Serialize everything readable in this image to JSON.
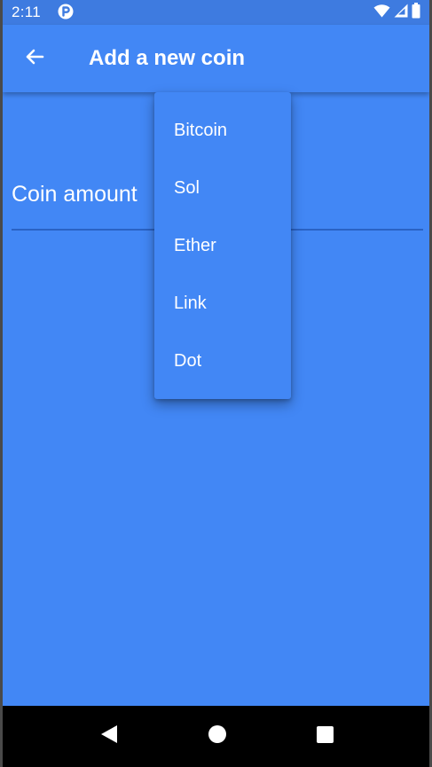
{
  "status_bar": {
    "time": "2:11",
    "app_icon": "p-circle-icon",
    "right_icons": [
      "wifi-icon",
      "signal-icon",
      "battery-icon"
    ]
  },
  "app_bar": {
    "back_icon": "arrow-back-icon",
    "title": "Add a new coin"
  },
  "form": {
    "coin_amount_label": "Coin amount"
  },
  "dropdown": {
    "items": [
      {
        "label": "Bitcoin"
      },
      {
        "label": "Sol"
      },
      {
        "label": "Ether"
      },
      {
        "label": "Link"
      },
      {
        "label": "Dot"
      }
    ]
  },
  "nav_bar": {
    "back_icon": "triangle-back-icon",
    "home_icon": "circle-home-icon",
    "recents_icon": "square-recents-icon"
  },
  "colors": {
    "primary": "#4287f5",
    "status_bar": "#3e7be0",
    "underline": "#2a62c4",
    "text": "#ffffff",
    "nav_bar": "#000000"
  }
}
